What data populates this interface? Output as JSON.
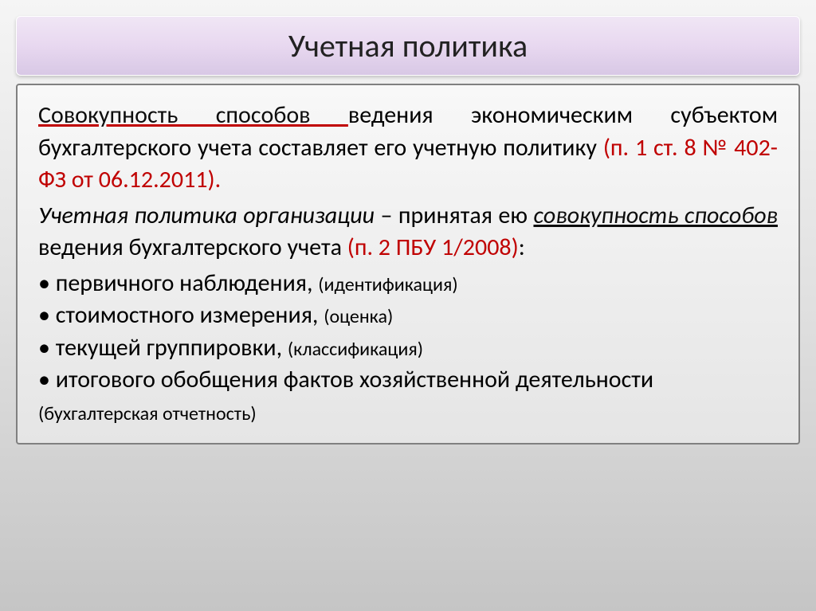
{
  "title": "Учетная политика",
  "paragraph1": {
    "underlined_phrase": "Совокупность способов ",
    "text_part1": "ведения экономическим субъектом бухгалтерского учета составляет его учетную политику ",
    "red_citation": "(п. 1 ст. 8 № 402-ФЗ от 06.12.2011).",
    "text_after": ""
  },
  "paragraph2": {
    "italic_part": "Учетная политика организации",
    "text_part1": " – принятая ею ",
    "underlined_phrase": "совокупность способов",
    "text_part2": " ведения бухгалтерского учета ",
    "red_citation": "(п. 2 ПБУ 1/2008)",
    "text_after": ":"
  },
  "bullets": [
    {
      "main": "• первичного наблюдения, ",
      "note": "(идентификация)"
    },
    {
      "main": "• стоимостного измерения, ",
      "note": "(оценка)"
    },
    {
      "main": "• текущей группировки, ",
      "note": "(классификация)"
    },
    {
      "main": "• итогового обобщения фактов хозяйственной деятельности ",
      "note": "(бухгалтерская отчетность)"
    }
  ]
}
